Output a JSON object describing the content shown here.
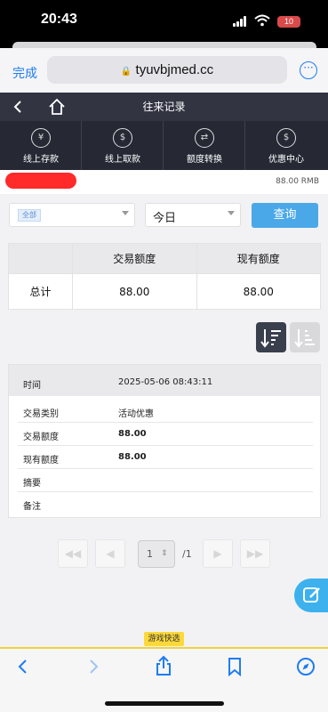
{
  "status_bar": {
    "time": "20:43",
    "battery": "10"
  },
  "browser": {
    "done_label": "完成",
    "url": "tyuvbjmed.cc",
    "more_icon": "ellipsis-circle-icon"
  },
  "nav": {
    "title": "往来记录"
  },
  "tabs": [
    {
      "label": "线上存款",
      "icon": "deposit-icon"
    },
    {
      "label": "线上取款",
      "icon": "withdraw-icon"
    },
    {
      "label": "额度转换",
      "icon": "exchange-icon"
    },
    {
      "label": "优惠中心",
      "icon": "promo-icon"
    }
  ],
  "balance": "88.00 RMB",
  "filters": {
    "type_tag": "全部",
    "date_range": "今日",
    "query_label": "查询"
  },
  "summary": {
    "headers": [
      "",
      "交易额度",
      "现有额度"
    ],
    "total_label": "总计",
    "total_amount": "88.00",
    "total_balance": "88.00"
  },
  "detail": {
    "time_label": "时间",
    "time_value": "2025-05-06 08:43:11",
    "rows": [
      {
        "key": "交易类别",
        "value": "活动优惠"
      },
      {
        "key": "交易额度",
        "value": "88.00"
      },
      {
        "key": "现有额度",
        "value": "88.00"
      },
      {
        "key": "摘要",
        "value": ""
      },
      {
        "key": "备注",
        "value": ""
      }
    ]
  },
  "pagination": {
    "current": "1",
    "total": "/1"
  },
  "suggestion": "游戏快选",
  "colors": {
    "nav": "#323442",
    "tabs": "#262934",
    "accent": "#1e7cf2",
    "query": "#4aa8e8"
  }
}
